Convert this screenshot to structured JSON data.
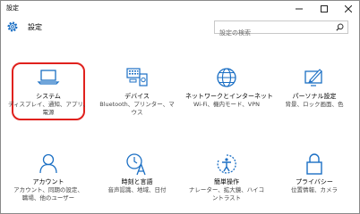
{
  "window": {
    "title": "設定",
    "controls": {
      "minimize": "─",
      "maximize": "☐",
      "close": "✕"
    }
  },
  "header": {
    "title": "設定",
    "search": {
      "placeholder": "設定の検索"
    }
  },
  "tiles": [
    {
      "label": "システム",
      "desc1": "ディスプレイ、通知、アプリ、",
      "desc2": "電源",
      "icon": "laptop-icon"
    },
    {
      "label": "デバイス",
      "desc1": "Bluetooth、プリンター、マ",
      "desc2": "ウス",
      "icon": "devices-icon"
    },
    {
      "label": "ネットワークとインターネット",
      "desc1": "Wi-Fi、機内モード、VPN",
      "desc2": "",
      "icon": "globe-icon"
    },
    {
      "label": "パーソナル設定",
      "desc1": "背景、ロック画面、色",
      "desc2": "",
      "icon": "personalization-icon"
    },
    {
      "label": "アカウント",
      "desc1": "アカウント、同期の設定、",
      "desc2": "職場、他のユーザー",
      "icon": "person-icon"
    },
    {
      "label": "時刻と言語",
      "desc1": "音声認識、地域、日付",
      "desc2": "",
      "icon": "time-language-icon"
    },
    {
      "label": "簡単操作",
      "desc1": "ナレーター、拡大鏡、ハイコ",
      "desc2": "ントラスト",
      "icon": "ease-of-access-icon"
    },
    {
      "label": "プライバシー",
      "desc1": "位置情報、カメラ",
      "desc2": "",
      "icon": "lock-icon"
    }
  ],
  "selected_tile": "システム",
  "colors": {
    "accent": "#1b6fc4",
    "highlight": "#e0211d"
  }
}
